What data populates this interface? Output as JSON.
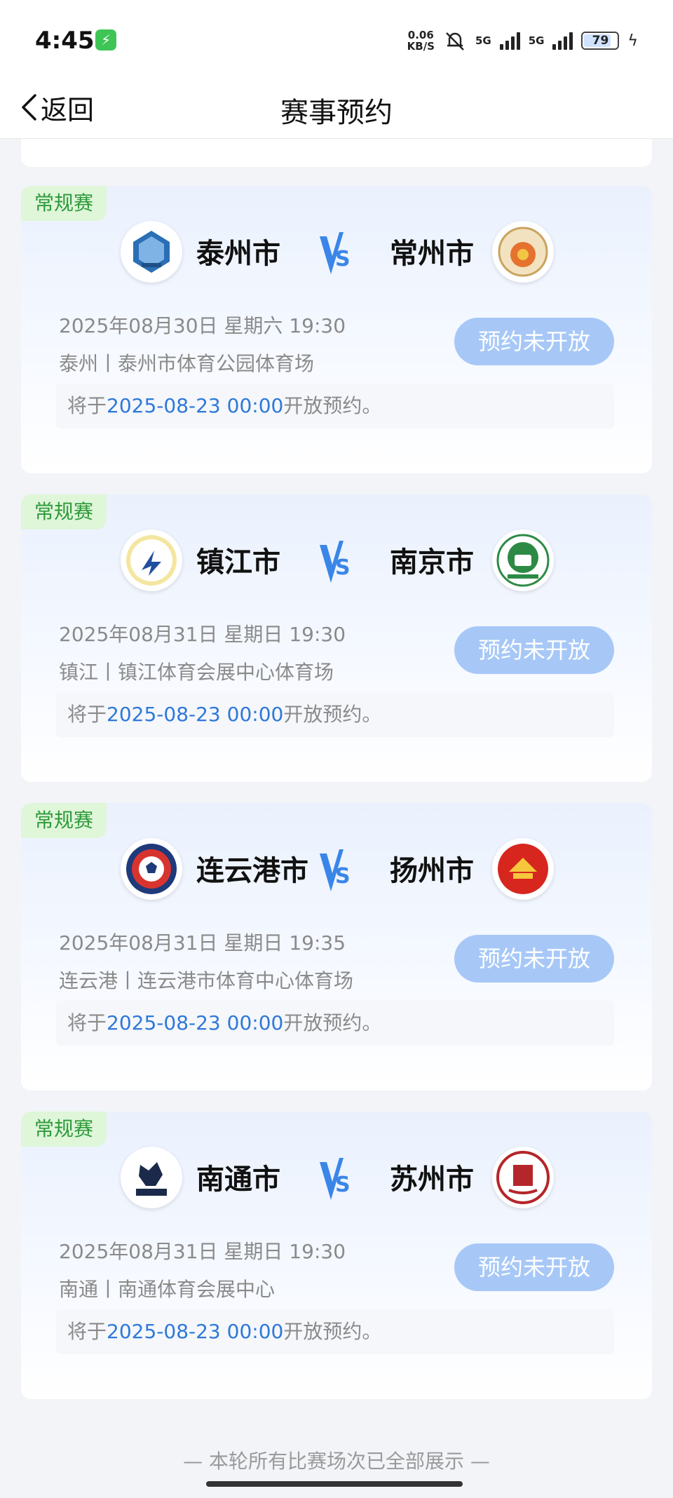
{
  "status_bar": {
    "time": "4:45",
    "net_speed_value": "0.06",
    "net_speed_unit": "KB/S",
    "sim1_label": "5G",
    "sim2_label": "5G",
    "battery": "79"
  },
  "nav": {
    "back_label": "返回",
    "title": "赛事预约"
  },
  "matches": [
    {
      "tag": "常规赛",
      "home": "泰州市",
      "away": "常州市",
      "datetime": "2025年08月30日 星期六 19:30",
      "venue": "泰州丨泰州市体育公园体育场",
      "button": "预约未开放",
      "notice_prefix": "将于",
      "notice_time": "2025-08-23 00:00",
      "notice_suffix": "开放预约。"
    },
    {
      "tag": "常规赛",
      "home": "镇江市",
      "away": "南京市",
      "datetime": "2025年08月31日 星期日 19:30",
      "venue": "镇江丨镇江体育会展中心体育场",
      "button": "预约未开放",
      "notice_prefix": "将于",
      "notice_time": "2025-08-23 00:00",
      "notice_suffix": "开放预约。"
    },
    {
      "tag": "常规赛",
      "home": "连云港市",
      "away": "扬州市",
      "datetime": "2025年08月31日 星期日 19:35",
      "venue": "连云港丨连云港市体育中心体育场",
      "button": "预约未开放",
      "notice_prefix": "将于",
      "notice_time": "2025-08-23 00:00",
      "notice_suffix": "开放预约。"
    },
    {
      "tag": "常规赛",
      "home": "南通市",
      "away": "苏州市",
      "datetime": "2025年08月31日 星期日 19:30",
      "venue": "南通丨南通体育会展中心",
      "button": "预约未开放",
      "notice_prefix": "将于",
      "notice_time": "2025-08-23 00:00",
      "notice_suffix": "开放预约。"
    }
  ],
  "footer": "— 本轮所有比赛场次已全部展示 —",
  "colors": {
    "accent": "#2f78d8",
    "button_bg": "#a7c8f7",
    "tag_bg": "#dff6d9",
    "tag_text": "#2e9a3a"
  }
}
